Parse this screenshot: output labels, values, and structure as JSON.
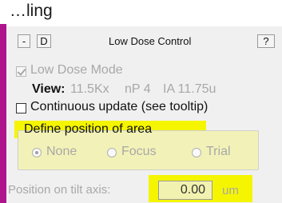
{
  "window": {
    "top_text": "…ling",
    "minimize_label": "-",
    "d_label": "D",
    "title": "Low Dose Control",
    "help_label": "?"
  },
  "low_dose_mode": {
    "label": "Low Dose Mode",
    "checked": true,
    "enabled": false
  },
  "view": {
    "label": "View:",
    "mag": "11.5Kx",
    "np": "nP 4",
    "ia": "IA 11.75u"
  },
  "continuous_update": {
    "label": "Continuous update (see tooltip)",
    "checked": false
  },
  "define_area": {
    "legend": "Define position of area",
    "options": [
      {
        "label": "None",
        "selected": true
      },
      {
        "label": "Focus",
        "selected": false
      },
      {
        "label": "Trial",
        "selected": false
      }
    ]
  },
  "tilt_axis": {
    "label": "Position on tilt axis:",
    "value": "0.00",
    "unit": "um"
  },
  "colors": {
    "highlight": "#f5f500",
    "accent_bar": "#b0148c"
  }
}
